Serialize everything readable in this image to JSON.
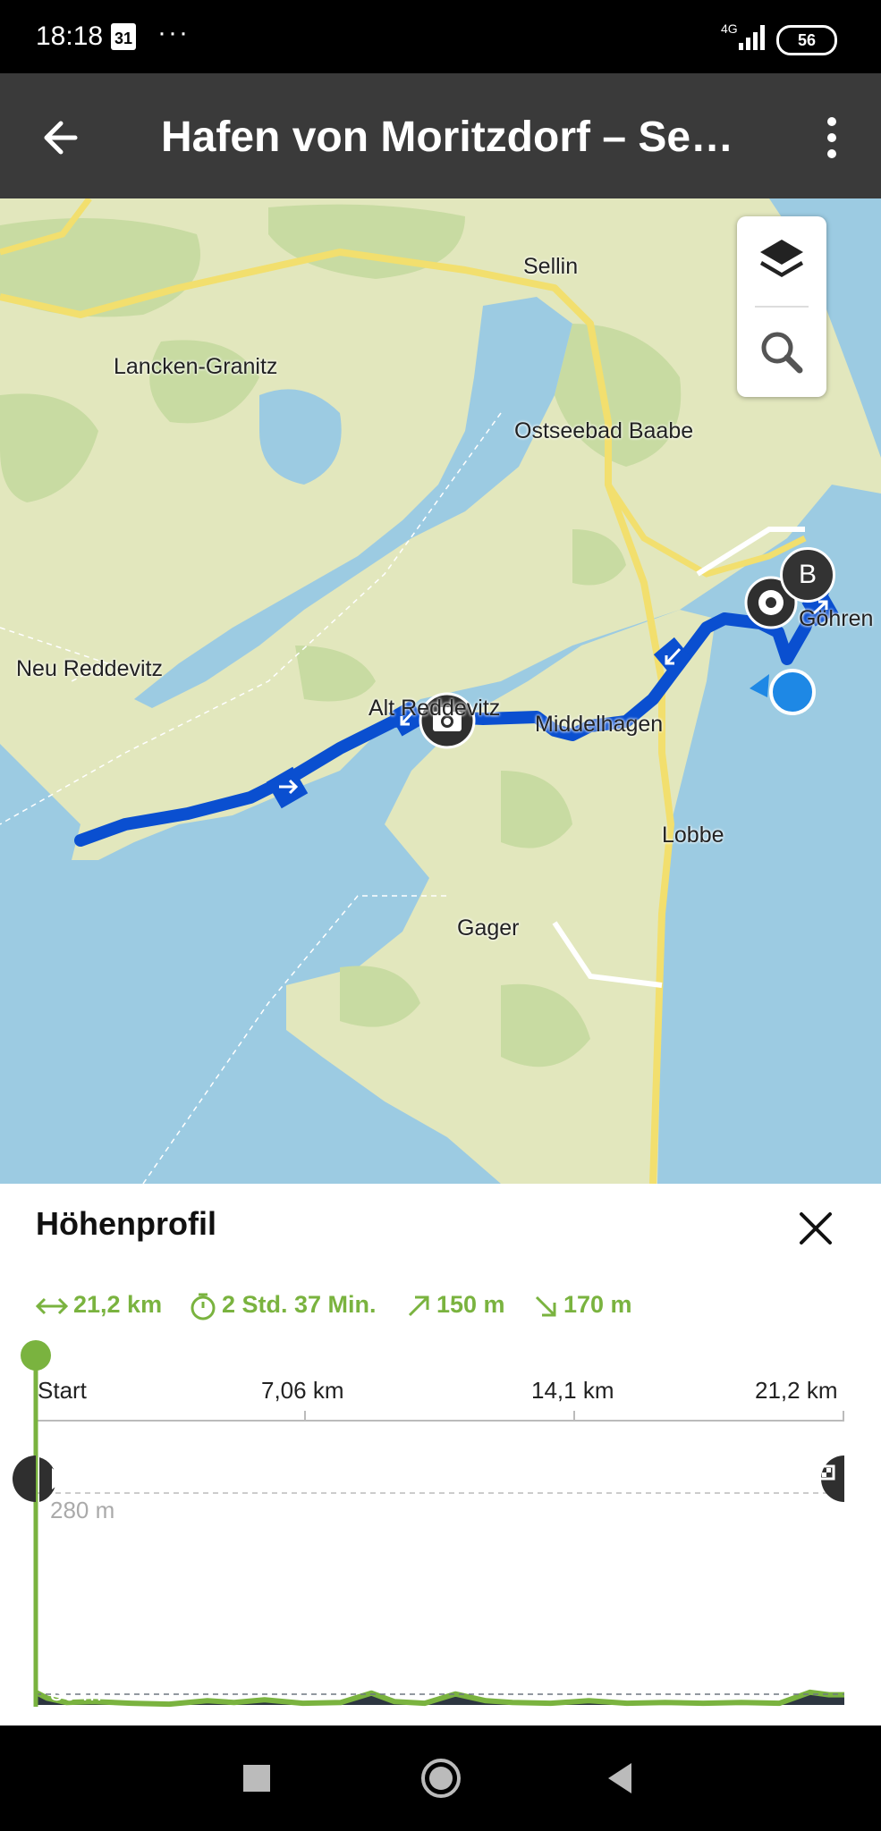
{
  "status_bar": {
    "time": "18:18",
    "calendar_day": "31",
    "network": "4G",
    "battery": "56"
  },
  "app_bar": {
    "title": "Hafen von Moritzdorf – See…"
  },
  "map": {
    "labels": {
      "sellin": "Sellin",
      "lancken": "Lancken-Granitz",
      "baabe": "Ostseebad Baabe",
      "neu_reddevitz": "Neu Reddevitz",
      "alt_reddevitz": "Alt Reddevitz",
      "middelhagen": "Middelhagen",
      "gohren": "Göhren",
      "lobbe": "Lobbe",
      "gager": "Gager"
    },
    "marker_b": "B"
  },
  "elevation_sheet": {
    "title": "Höhenprofil",
    "stats": {
      "distance": "21,2 km",
      "duration": "2 Std. 37 Min.",
      "ascent": "150 m",
      "descent": "170 m"
    },
    "x_ticks": [
      "Start",
      "7,06 km",
      "14,1 km",
      "21,2 km"
    ],
    "y_labels": {
      "max": "280 m",
      "min": "30 m"
    }
  },
  "chart_data": {
    "type": "area",
    "title": "Höhenprofil",
    "xlabel": "",
    "ylabel": "",
    "xlim": [
      0,
      21.2
    ],
    "ylim": [
      30,
      280
    ],
    "x_tick_labels": [
      "Start",
      "7,06 km",
      "14,1 km",
      "21,2 km"
    ],
    "y_tick_labels": [
      "280 m",
      "30 m"
    ],
    "x": [
      0,
      0.3,
      0.8,
      1.5,
      2.5,
      3.5,
      4.5,
      5.2,
      6.0,
      7.0,
      8.0,
      8.8,
      9.4,
      10.2,
      11.0,
      11.8,
      12.5,
      13.5,
      14.5,
      15.5,
      16.5,
      17.5,
      18.5,
      19.5,
      20.3,
      20.8,
      21.2
    ],
    "y": [
      45,
      38,
      33,
      34,
      32,
      31,
      35,
      33,
      36,
      32,
      33,
      44,
      34,
      32,
      43,
      35,
      33,
      32,
      35,
      32,
      33,
      32,
      33,
      32,
      45,
      42,
      42
    ]
  }
}
